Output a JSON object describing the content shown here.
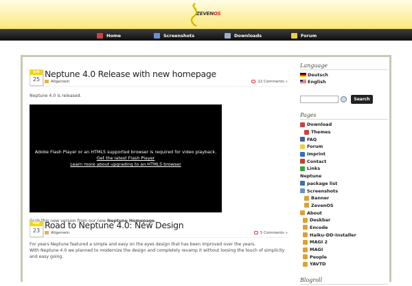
{
  "logo": {
    "text": "ZEVEN",
    "accent": "OS"
  },
  "nav": [
    {
      "label": "Home",
      "icon": "home-icon",
      "color": "#d04040"
    },
    {
      "label": "Screenshots",
      "icon": "screenshots-icon",
      "color": "#6a8fd0"
    },
    {
      "label": "Downloads",
      "icon": "downloads-icon",
      "color": "#9ab0d0"
    },
    {
      "label": "Forum",
      "icon": "forum-icon",
      "color": "#e8d040"
    }
  ],
  "posts": [
    {
      "month": "JUN",
      "day": "25",
      "title": "Neptune 4.0 Release with new homepage",
      "category": "Allgemein",
      "comments": "12 Comments »",
      "intro": "Neptune 4.0 is released.",
      "video": {
        "line1": "Adobe Flash Player or an HTML5 supported browser is required for video playback.",
        "link1": "Get the latest Flash Player",
        "link2": "Learn more about upgrading to an HTML5 browser"
      },
      "outro_pre": "Grab this new version from our new ",
      "outro_bold": "Neptune Homepage",
      "outro_post": "."
    },
    {
      "month": "MAY",
      "day": "23",
      "title": "Road to Neptune 4.0: New Design",
      "category": "Allgemein",
      "comments": "5 Comments »",
      "text1": "For years Neptune featured a simple and easy on the eyes design that has been improved over the years.",
      "text2": "With Neptune 4.0 we planned to modernize the design and completely revamp it without loosing the touch of simplicity",
      "text3": "and easy going."
    }
  ],
  "sidebar": {
    "language_heading": "Language",
    "languages": [
      "Deutsch",
      "English"
    ],
    "search_button": "Search",
    "pages_heading": "Pages",
    "pages": [
      {
        "label": "Download",
        "level": 1,
        "icon": "download-icon",
        "color": "#d04040"
      },
      {
        "label": "Themes",
        "level": 2,
        "icon": "themes-icon",
        "color": "#d04040"
      },
      {
        "label": "FAQ",
        "level": 1,
        "icon": "faq-icon",
        "color": "#4060a0"
      },
      {
        "label": "Forum",
        "level": 1,
        "icon": "forum-icon",
        "color": "#e8d040"
      },
      {
        "label": "Imprint",
        "level": 1,
        "icon": "imprint-icon",
        "color": "#3070c0"
      },
      {
        "label": "Contact",
        "level": 1,
        "icon": "contact-icon",
        "color": "#c04030"
      },
      {
        "label": "Links",
        "level": 1,
        "icon": "links-icon",
        "color": "#40a040"
      },
      {
        "label": "Neptune",
        "level": 0,
        "icon": "",
        "color": ""
      },
      {
        "label": "package list",
        "level": 1,
        "icon": "package-icon",
        "color": "#3a70b0"
      },
      {
        "label": "Screenshots",
        "level": 1,
        "icon": "screenshots-icon",
        "color": "#6a8fd0"
      },
      {
        "label": "Banner",
        "level": 2,
        "icon": "banner-icon",
        "color": "#e0a030"
      },
      {
        "label": "ZevenOS",
        "level": 2,
        "icon": "zevenos-icon",
        "color": "#e0a030"
      },
      {
        "label": "About",
        "level": 1,
        "icon": "about-icon",
        "color": "#e0a030"
      },
      {
        "label": "Deskbar",
        "level": 3,
        "icon": "deskbar-icon",
        "color": "#e0a030"
      },
      {
        "label": "Encode",
        "level": 3,
        "icon": "encode-icon",
        "color": "#e0a030"
      },
      {
        "label": "Haiku-DD-Installer",
        "level": 3,
        "icon": "haiku-icon",
        "color": "#e0a030"
      },
      {
        "label": "MAGI 2",
        "level": 3,
        "icon": "magi2-icon",
        "color": "#e0a030"
      },
      {
        "label": "MAGI",
        "level": 3,
        "icon": "magi-icon",
        "color": "#e0a030"
      },
      {
        "label": "People",
        "level": 3,
        "icon": "people-icon",
        "color": "#e0a030"
      },
      {
        "label": "YAVTD",
        "level": 3,
        "icon": "yavtd-icon",
        "color": "#e0a030"
      }
    ],
    "blogroll_heading": "Blogroll"
  }
}
